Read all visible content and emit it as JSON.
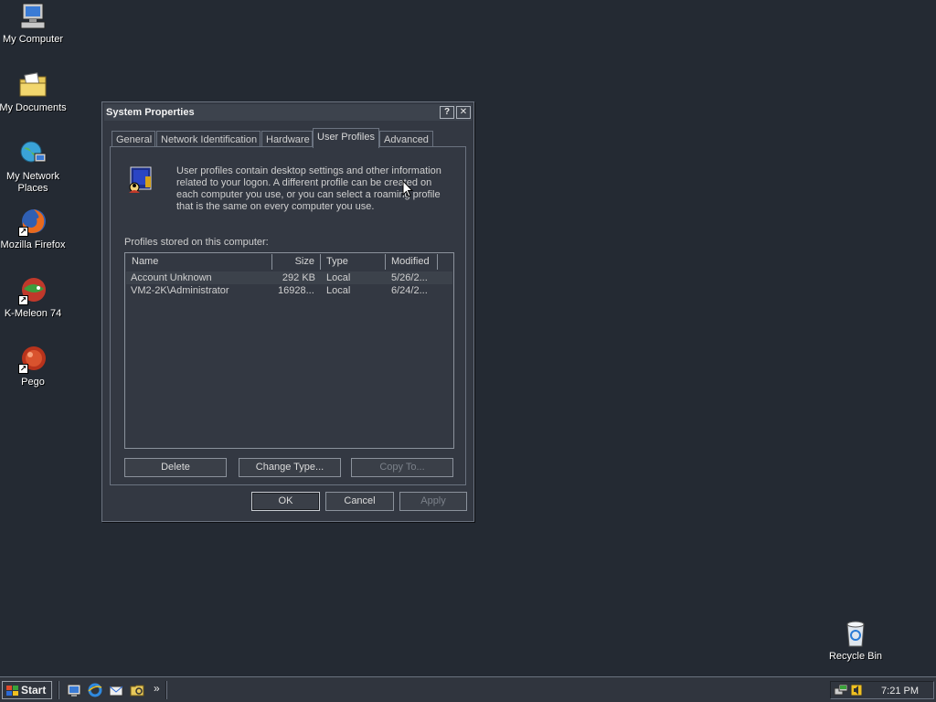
{
  "desktop": {
    "icons": [
      {
        "label": "My Computer",
        "icon": "my-computer-icon"
      },
      {
        "label": "My Documents",
        "icon": "my-documents-icon"
      },
      {
        "label": "My Network Places",
        "icon": "network-places-icon"
      },
      {
        "label": "Mozilla Firefox",
        "icon": "firefox-icon"
      },
      {
        "label": "K-Meleon 74",
        "icon": "k-meleon-icon"
      },
      {
        "label": "Pego",
        "icon": "pego-icon"
      },
      {
        "label": "Recycle Bin",
        "icon": "recycle-bin-icon"
      }
    ]
  },
  "dialog": {
    "title": "System Properties",
    "help_label": "?",
    "close_label": "✕",
    "tabs": [
      {
        "label": "General"
      },
      {
        "label": "Network Identification"
      },
      {
        "label": "Hardware"
      },
      {
        "label": "User Profiles",
        "active": true
      },
      {
        "label": "Advanced"
      }
    ],
    "description": "User profiles contain desktop settings and other information related to your logon.  A different profile can be created on each computer you use, or you can select a roaming profile that is the same on every computer you use.",
    "profiles_label": "Profiles stored on this computer:",
    "columns": [
      "Name",
      "Size",
      "Type",
      "Modified"
    ],
    "rows": [
      {
        "name": "Account Unknown",
        "size": "292 KB",
        "type": "Local",
        "modified": "5/26/2..."
      },
      {
        "name": "VM2-2K\\Administrator",
        "size": "16928...",
        "type": "Local",
        "modified": "6/24/2..."
      }
    ],
    "buttons": {
      "delete": "Delete",
      "change_type": "Change Type...",
      "copy_to": "Copy To...",
      "ok": "OK",
      "cancel": "Cancel",
      "apply": "Apply"
    }
  },
  "taskbar": {
    "start_label": "Start",
    "chevron": "»",
    "clock": "7:21 PM"
  }
}
